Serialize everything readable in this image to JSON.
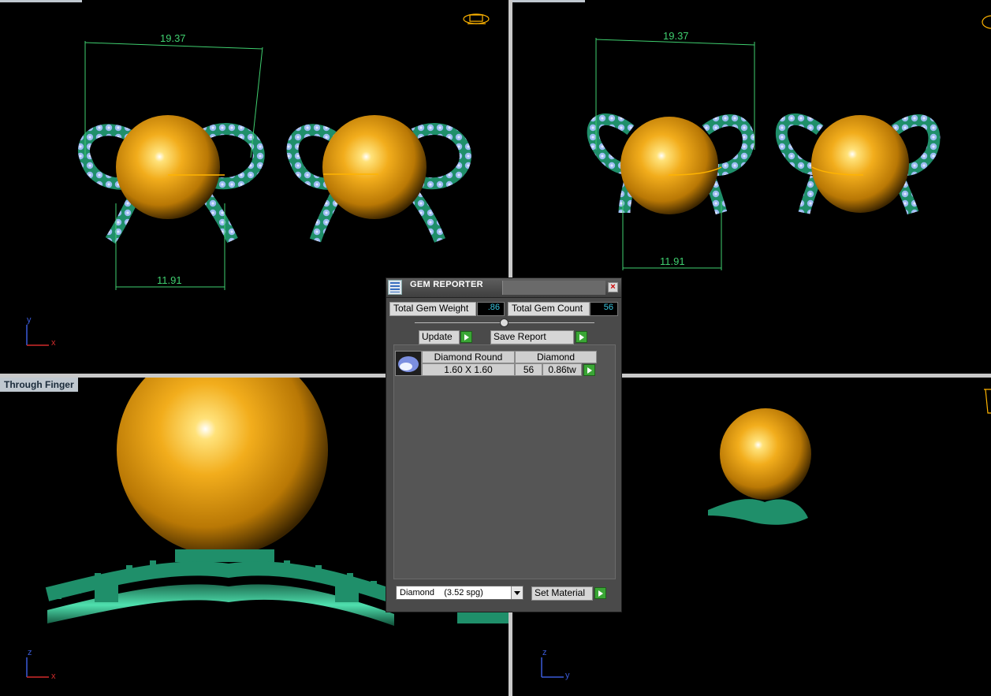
{
  "viewports": {
    "top_left": {
      "dimension_width": "19.37",
      "dimension_bottom": "11.91",
      "axis_a": "y",
      "axis_b": "x"
    },
    "top_right": {
      "dimension_width": "19.37",
      "dimension_bottom": "11.91"
    },
    "bottom_left": {
      "label": "Through Finger",
      "axis_a": "z",
      "axis_b": "x"
    },
    "bottom_right": {
      "axis_a": "z",
      "axis_b": "y"
    }
  },
  "gem_reporter": {
    "title": "GEM REPORTER",
    "total_weight_label": "Total Gem Weight",
    "total_weight_value": ".86",
    "total_count_label": "Total Gem Count",
    "total_count_value": "56",
    "update_label": "Update",
    "save_report_label": "Save Report",
    "gems": [
      {
        "shape": "Diamond Round",
        "material": "Diamond",
        "size": "1.60 X 1.60",
        "count": "56",
        "weight": "0.86tw"
      }
    ],
    "material_select": "Diamond    (3.52 spg)",
    "set_material_label": "Set Material"
  },
  "colors": {
    "gold": "#e7a417",
    "band": "#1f8f6a",
    "gem": "#8fb3ee",
    "dimension": "#3fcf6f",
    "axis_red": "#d12b2b",
    "axis_blue": "#3b5bd8"
  }
}
